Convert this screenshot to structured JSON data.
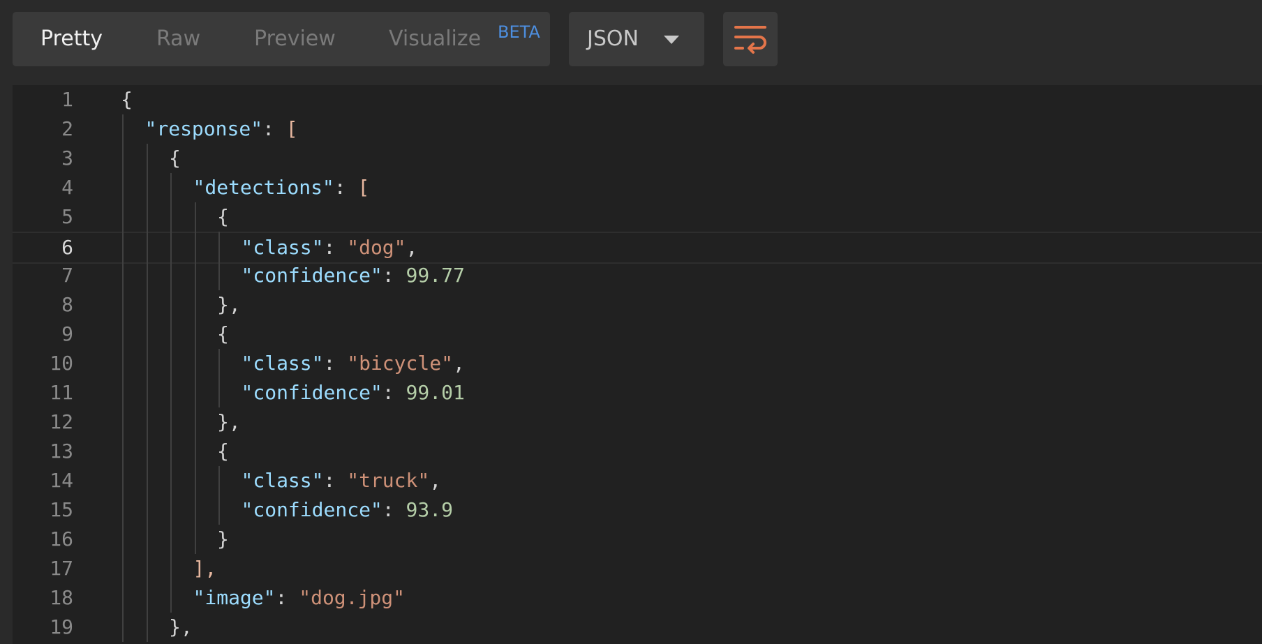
{
  "toolbar": {
    "tabs": [
      "Pretty",
      "Raw",
      "Preview",
      "Visualize"
    ],
    "beta_badge": "BETA",
    "format": "JSON",
    "wrap_icon": "word-wrap-icon"
  },
  "colors": {
    "key": "#9cdcfe",
    "string": "#ce9178",
    "number": "#b5cea8",
    "accent": "#e4754a",
    "beta": "#4d8fe0"
  },
  "editor": {
    "current_line": 6,
    "lines": [
      {
        "n": "1",
        "indent": 0,
        "tokens": [
          [
            "p",
            "{"
          ]
        ]
      },
      {
        "n": "2",
        "indent": 1,
        "tokens": [
          [
            "k",
            "\"response\""
          ],
          [
            "p",
            ": "
          ],
          [
            "b",
            "["
          ]
        ]
      },
      {
        "n": "3",
        "indent": 2,
        "tokens": [
          [
            "p",
            "{"
          ]
        ]
      },
      {
        "n": "4",
        "indent": 3,
        "tokens": [
          [
            "k",
            "\"detections\""
          ],
          [
            "p",
            ": "
          ],
          [
            "b",
            "["
          ]
        ]
      },
      {
        "n": "5",
        "indent": 4,
        "tokens": [
          [
            "p",
            "{"
          ]
        ]
      },
      {
        "n": "6",
        "indent": 5,
        "tokens": [
          [
            "k",
            "\"class\""
          ],
          [
            "p",
            ": "
          ],
          [
            "s",
            "\"dog\""
          ],
          [
            "p",
            ","
          ]
        ]
      },
      {
        "n": "7",
        "indent": 5,
        "tokens": [
          [
            "k",
            "\"confidence\""
          ],
          [
            "p",
            ": "
          ],
          [
            "n",
            "99.77"
          ]
        ]
      },
      {
        "n": "8",
        "indent": 4,
        "tokens": [
          [
            "p",
            "},"
          ]
        ]
      },
      {
        "n": "9",
        "indent": 4,
        "tokens": [
          [
            "p",
            "{"
          ]
        ]
      },
      {
        "n": "10",
        "indent": 5,
        "tokens": [
          [
            "k",
            "\"class\""
          ],
          [
            "p",
            ": "
          ],
          [
            "s",
            "\"bicycle\""
          ],
          [
            "p",
            ","
          ]
        ]
      },
      {
        "n": "11",
        "indent": 5,
        "tokens": [
          [
            "k",
            "\"confidence\""
          ],
          [
            "p",
            ": "
          ],
          [
            "n",
            "99.01"
          ]
        ]
      },
      {
        "n": "12",
        "indent": 4,
        "tokens": [
          [
            "p",
            "},"
          ]
        ]
      },
      {
        "n": "13",
        "indent": 4,
        "tokens": [
          [
            "p",
            "{"
          ]
        ]
      },
      {
        "n": "14",
        "indent": 5,
        "tokens": [
          [
            "k",
            "\"class\""
          ],
          [
            "p",
            ": "
          ],
          [
            "s",
            "\"truck\""
          ],
          [
            "p",
            ","
          ]
        ]
      },
      {
        "n": "15",
        "indent": 5,
        "tokens": [
          [
            "k",
            "\"confidence\""
          ],
          [
            "p",
            ": "
          ],
          [
            "n",
            "93.9"
          ]
        ]
      },
      {
        "n": "16",
        "indent": 4,
        "tokens": [
          [
            "p",
            "}"
          ]
        ]
      },
      {
        "n": "17",
        "indent": 3,
        "tokens": [
          [
            "b",
            "],"
          ]
        ]
      },
      {
        "n": "18",
        "indent": 3,
        "tokens": [
          [
            "k",
            "\"image\""
          ],
          [
            "p",
            ": "
          ],
          [
            "s",
            "\"dog.jpg\""
          ]
        ]
      },
      {
        "n": "19",
        "indent": 2,
        "tokens": [
          [
            "p",
            "},"
          ]
        ]
      }
    ]
  }
}
